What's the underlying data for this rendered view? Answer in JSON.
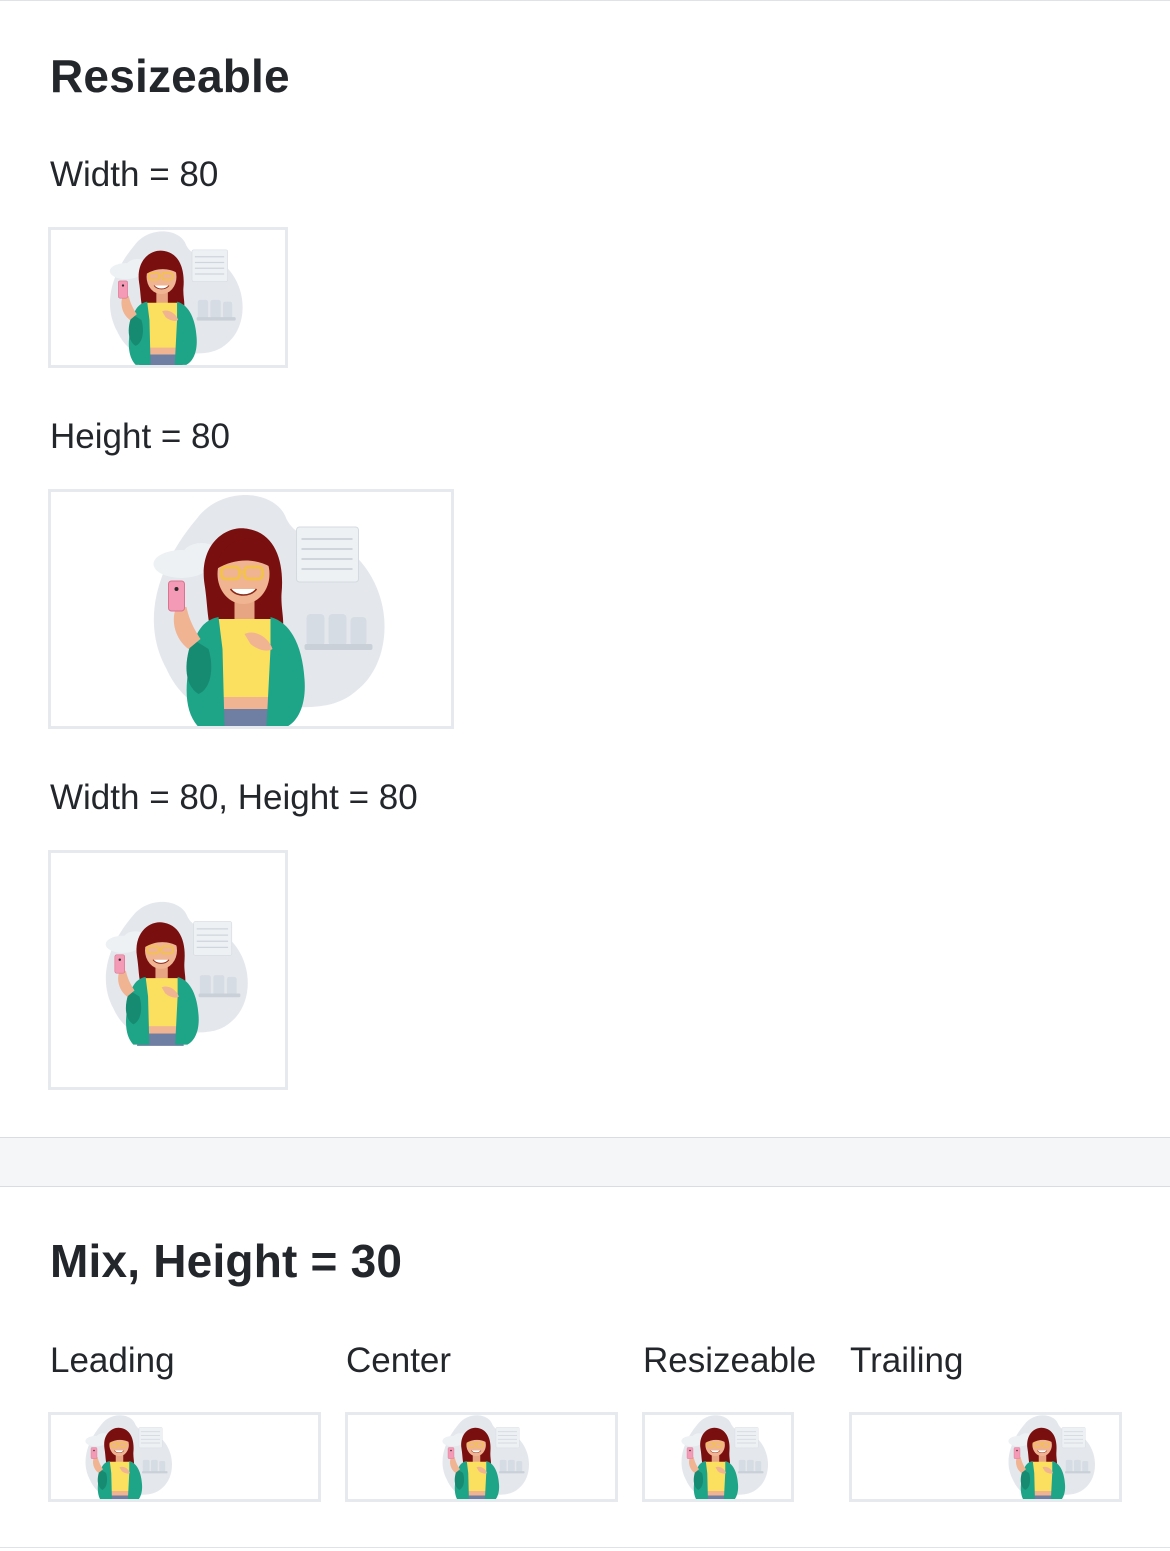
{
  "sections": {
    "resizeable": {
      "title": "Resizeable",
      "labels": {
        "width": "Width = 80",
        "height": "Height = 80",
        "both": "Width = 80, Height = 80"
      }
    },
    "mix": {
      "title": "Mix, Height = 30",
      "columns": [
        "Leading",
        "Center",
        "Resizeable",
        "Trailing"
      ]
    }
  },
  "illustration": {
    "name": "woman-with-phone-illustration",
    "colors": {
      "hair": "#7a0f0f",
      "skin": "#f0b493",
      "cardigan": "#1ea487",
      "shirt": "#fbe05f",
      "pants": "#6f7ea3",
      "glasses": "#f2c14e",
      "phone": "#f59ab6",
      "backdrop": "#e3e7ec"
    }
  }
}
